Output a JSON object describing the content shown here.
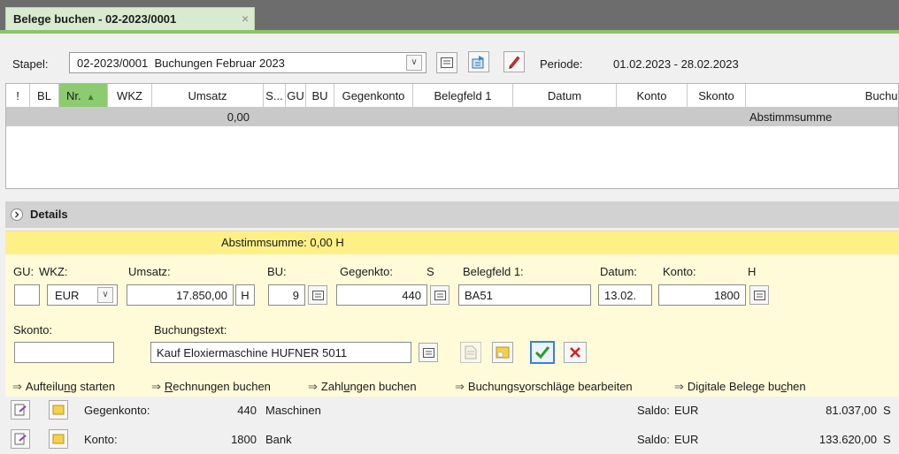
{
  "tab": {
    "title": "Belege buchen - 02-2023/0001",
    "close": "×"
  },
  "toolbar": {
    "stapel_label": "Stapel:",
    "stapel_value": "02-2023/0001  Buchungen Februar 2023",
    "periode_label": "Periode:",
    "periode_value": "01.02.2023 - 28.02.2023"
  },
  "grid": {
    "columns": [
      "!",
      "BL",
      "Nr.",
      "WKZ",
      "Umsatz",
      "S...",
      "GU",
      "BU",
      "Gegenkonto",
      "Belegfeld 1",
      "Datum",
      "Konto",
      "Skonto",
      "Buchung"
    ],
    "sum_value": "0,00",
    "sum_label": "Abstimmsumme"
  },
  "details": {
    "header": "Details",
    "abstimmsumme": "Abstimmsumme: 0,00 H",
    "labels": {
      "gu": "GU:",
      "wkz": "WKZ:",
      "umsatz": "Umsatz:",
      "bu": "BU:",
      "gegenkto": "Gegenkto:",
      "s": "S",
      "belegfeld": "Belegfeld 1:",
      "datum": "Datum:",
      "konto": "Konto:",
      "h": "H",
      "skonto": "Skonto:",
      "buchungstext": "Buchungstext:"
    },
    "values": {
      "gu": "",
      "wkz": "EUR",
      "umsatz": "17.850,00",
      "umsatz_sh": "H",
      "bu": "9",
      "gegenkto": "440",
      "belegfeld": "BA51",
      "datum": "13.02.",
      "konto": "1800",
      "skonto": "",
      "buchungstext": "Kauf Eloxiermaschine HUFNER 5011"
    }
  },
  "links": [
    {
      "pre": "Aufteilu",
      "u": "n",
      "post": "g starten"
    },
    {
      "pre": "",
      "u": "R",
      "post": "echnungen buchen"
    },
    {
      "pre": "Zahl",
      "u": "u",
      "post": "ngen buchen"
    },
    {
      "pre": "Buchungs",
      "u": "v",
      "post": "orschläge bearbeiten"
    },
    {
      "pre": "Digitale Belege bu",
      "u": "c",
      "post": "hen"
    }
  ],
  "accounts": [
    {
      "label": "Gegenkonto:",
      "number": "440",
      "name": "Maschinen",
      "saldo_label": "Saldo:",
      "currency": "EUR",
      "amount": "81.037,00",
      "side": "S"
    },
    {
      "label": "Konto:",
      "number": "1800",
      "name": "Bank",
      "saldo_label": "Saldo:",
      "currency": "EUR",
      "amount": "133.620,00",
      "side": "S"
    }
  ],
  "colors": {
    "accent_green": "#8dc36c",
    "tab_bg": "#d8ead0",
    "detail_yellow": "#fffbd9",
    "sum_yellow": "#fef086"
  }
}
